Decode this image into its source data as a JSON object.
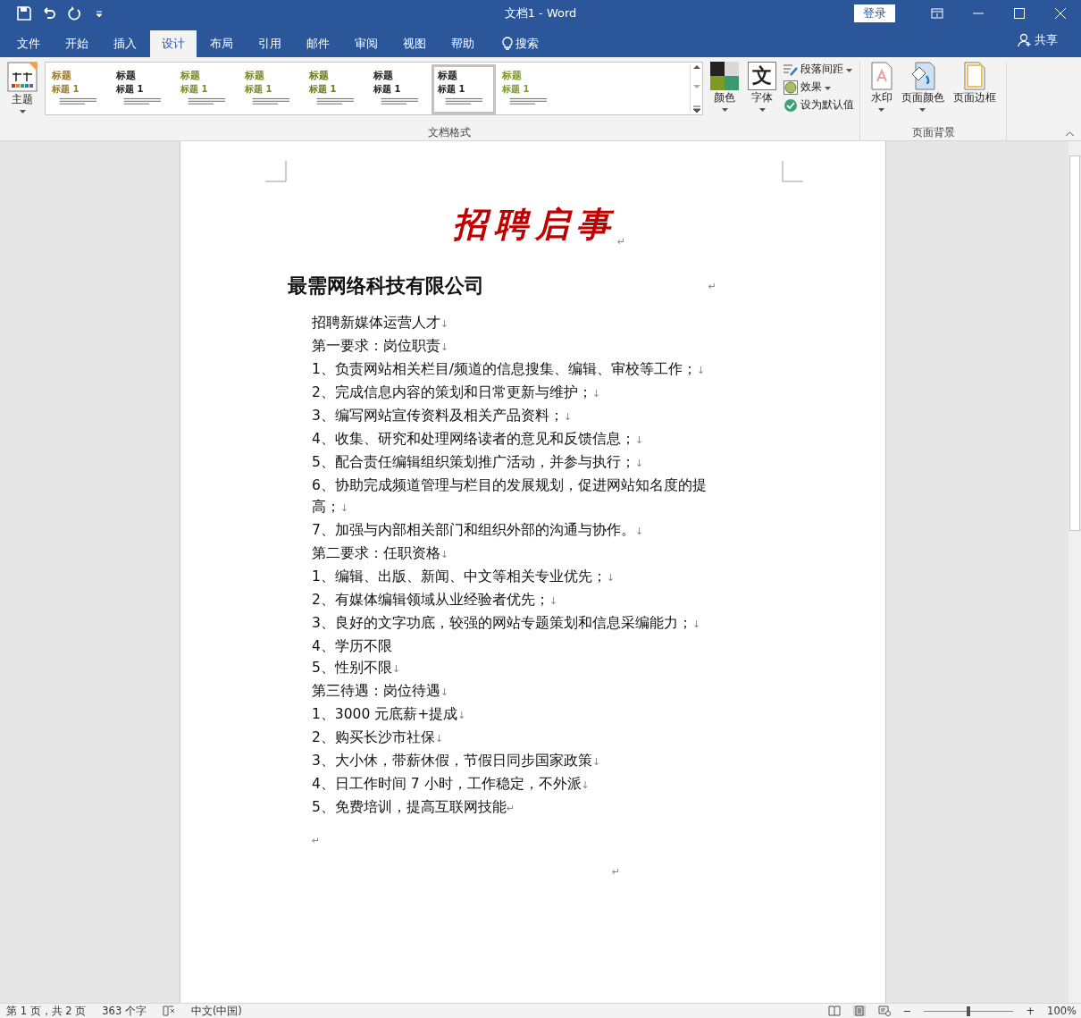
{
  "title_bar": {
    "title": "文档1  -  Word",
    "login": "登录"
  },
  "tabs": [
    {
      "label": "文件",
      "selected": false
    },
    {
      "label": "开始",
      "selected": false
    },
    {
      "label": "插入",
      "selected": false
    },
    {
      "label": "设计",
      "selected": true
    },
    {
      "label": "布局",
      "selected": false
    },
    {
      "label": "引用",
      "selected": false
    },
    {
      "label": "邮件",
      "selected": false
    },
    {
      "label": "审阅",
      "selected": false
    },
    {
      "label": "视图",
      "selected": false
    },
    {
      "label": "帮助",
      "selected": false
    }
  ],
  "search": "搜索",
  "share": "共享",
  "ribbon": {
    "theme": "主题",
    "styles": [
      {
        "heading": "标题",
        "subheading": "标题 1",
        "color": "#9c7a2a",
        "selected": false
      },
      {
        "heading": "标题",
        "subheading": "标题 1",
        "color": "#222222",
        "selected": false
      },
      {
        "heading": "标题",
        "subheading": "标题 1",
        "color": "#7a8a2a",
        "selected": false
      },
      {
        "heading": "标题",
        "subheading": "标题 1",
        "color": "#7a8a2a",
        "selected": false
      },
      {
        "heading": "标题",
        "subheading": "标题 1",
        "color": "#6b7a20",
        "selected": false
      },
      {
        "heading": "标题",
        "subheading": "标题 1",
        "color": "#222222",
        "selected": false
      },
      {
        "heading": "标题",
        "subheading": "标题 1",
        "color": "#222222",
        "selected": true
      },
      {
        "heading": "标题",
        "subheading": "标题 1",
        "color": "#7c9a2a",
        "selected": false
      }
    ],
    "colors": "颜色",
    "font_glyph": "文",
    "fonts": "字体",
    "small_buttons": [
      {
        "kind": "spacing",
        "label": "段落间距",
        "dropdown": true
      },
      {
        "kind": "effects",
        "label": "效果",
        "dropdown": true
      },
      {
        "kind": "default",
        "label": "设为默认值",
        "dropdown": false
      }
    ],
    "format_group": "文档格式",
    "background_buttons": [
      {
        "kind": "watermark",
        "label": "水印",
        "dropdown": true
      },
      {
        "kind": "pagecolor",
        "label": "页面颜色",
        "dropdown": true
      },
      {
        "kind": "border",
        "label": "页面边框",
        "dropdown": false
      }
    ],
    "background_group": "页面背景"
  },
  "document": {
    "title": "招聘启事",
    "title_mark": "↵",
    "company": "最需网络科技有限公司",
    "company_mark": "↵",
    "lines": [
      {
        "text": "招聘新媒体运营人才",
        "mark": "↓"
      },
      {
        "text": "第一要求：岗位职责",
        "mark": "↓"
      },
      {
        "text": "1、负责网站相关栏目/频道的信息搜集、编辑、审校等工作；",
        "mark": "↓"
      },
      {
        "text": "2、完成信息内容的策划和日常更新与维护；",
        "mark": "↓"
      },
      {
        "text": "3、编写网站宣传资料及相关产品资料；",
        "mark": "↓"
      },
      {
        "text": "4、收集、研究和处理网络读者的意见和反馈信息；",
        "mark": "↓"
      },
      {
        "text": "5、配合责任编辑组织策划推广活动，并参与执行；",
        "mark": "↓"
      },
      {
        "text": "6、协助完成频道管理与栏目的发展规划，促进网站知名度的提高；",
        "mark": "↓"
      },
      {
        "text": "7、加强与内部相关部门和组织外部的沟通与协作。",
        "mark": "↓"
      },
      {
        "text": "第二要求：任职资格",
        "mark": "↓"
      },
      {
        "text": "1、编辑、出版、新闻、中文等相关专业优先；",
        "mark": "↓"
      },
      {
        "text": "2、有媒体编辑领域从业经验者优先；",
        "mark": "↓"
      },
      {
        "text": "3、良好的文字功底，较强的网站专题策划和信息采编能力；",
        "mark": "↓"
      },
      {
        "text": "4、学历不限"
      },
      {
        "text": "5、性别不限",
        "mark": "↓"
      },
      {
        "text": "第三待遇：岗位待遇",
        "mark": "↓"
      },
      {
        "text": "1、3000 元底薪+提成",
        "mark": "↓"
      },
      {
        "text": "2、购买长沙市社保",
        "mark": "↓"
      },
      {
        "text": "3、大小休，带薪休假，节假日同步国家政策",
        "mark": "↓"
      },
      {
        "text": "4、日工作时间 7 小时，工作稳定，不外派",
        "mark": "↓"
      },
      {
        "text": "5、免费培训，提高互联网技能",
        "mark": "↵"
      }
    ],
    "empty_marks": [
      "↵",
      "↵"
    ]
  },
  "status_bar": {
    "page": "第 1 页，共 2 页",
    "words": "363 个字",
    "language": "中文(中国)",
    "zoom_out": "−",
    "zoom_slider": {
      "level": 0.5
    },
    "zoom_in": "+",
    "zoom": "100%"
  }
}
